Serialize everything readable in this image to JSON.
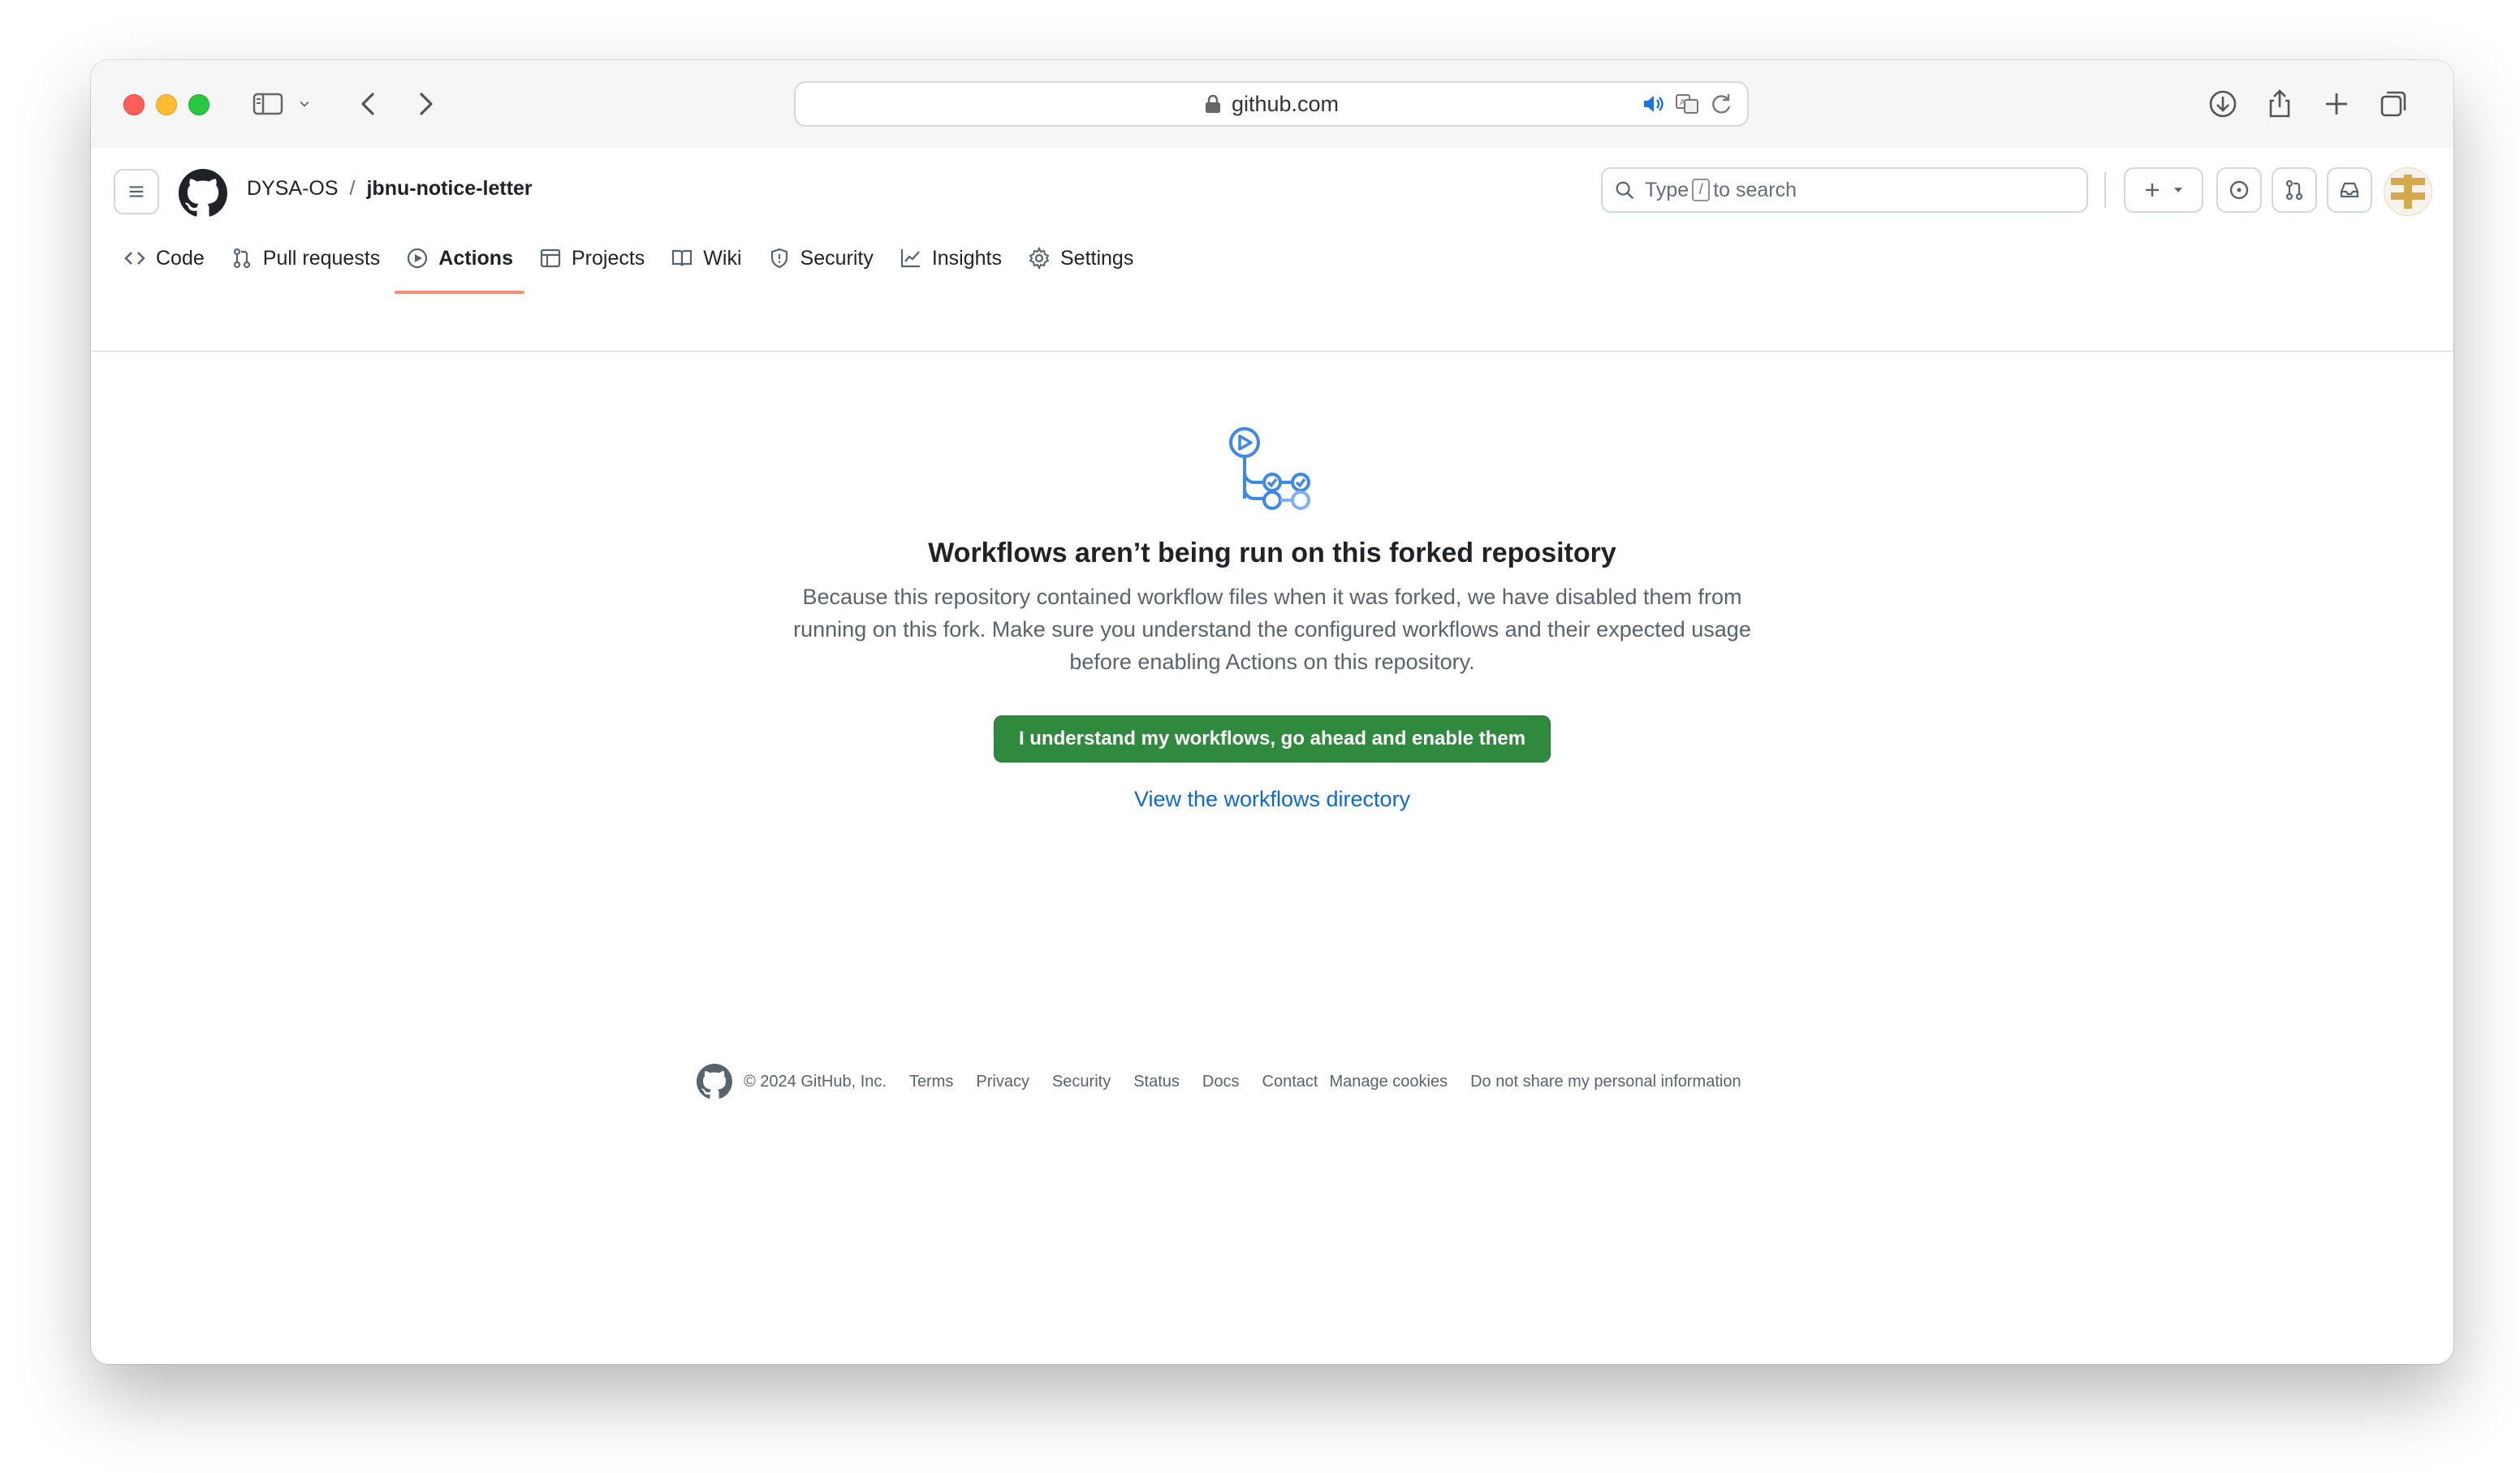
{
  "browser": {
    "url": "github.com"
  },
  "header": {
    "owner": "DYSA-OS",
    "separator": "/",
    "repo": "jbnu-notice-letter",
    "search_prefix": "Type",
    "search_key": "/",
    "search_suffix": "to search"
  },
  "nav": {
    "items": [
      {
        "label": "Code",
        "icon": "code-icon"
      },
      {
        "label": "Pull requests",
        "icon": "pull-request-icon"
      },
      {
        "label": "Actions",
        "icon": "play-icon",
        "active": true
      },
      {
        "label": "Projects",
        "icon": "table-icon"
      },
      {
        "label": "Wiki",
        "icon": "book-icon"
      },
      {
        "label": "Security",
        "icon": "shield-icon"
      },
      {
        "label": "Insights",
        "icon": "graph-icon"
      },
      {
        "label": "Settings",
        "icon": "gear-icon"
      }
    ]
  },
  "blankslate": {
    "title": "Workflows aren’t being run on this forked repository",
    "description": "Because this repository contained workflow files when it was forked, we have disabled them from running on this fork. Make sure you understand the configured workflows and their expected usage before enabling Actions on this repository.",
    "enable_button": "I understand my workflows, go ahead and enable them",
    "directory_link": "View the workflows directory"
  },
  "footer": {
    "copyright": "© 2024 GitHub, Inc.",
    "links": [
      "Terms",
      "Privacy",
      "Security",
      "Status",
      "Docs",
      "Contact",
      "Manage cookies",
      "Do not share my personal information"
    ]
  },
  "colors": {
    "primary_button": "#2f8a3e",
    "link": "#0969da",
    "active_tab_underline": "#fd8c73"
  }
}
